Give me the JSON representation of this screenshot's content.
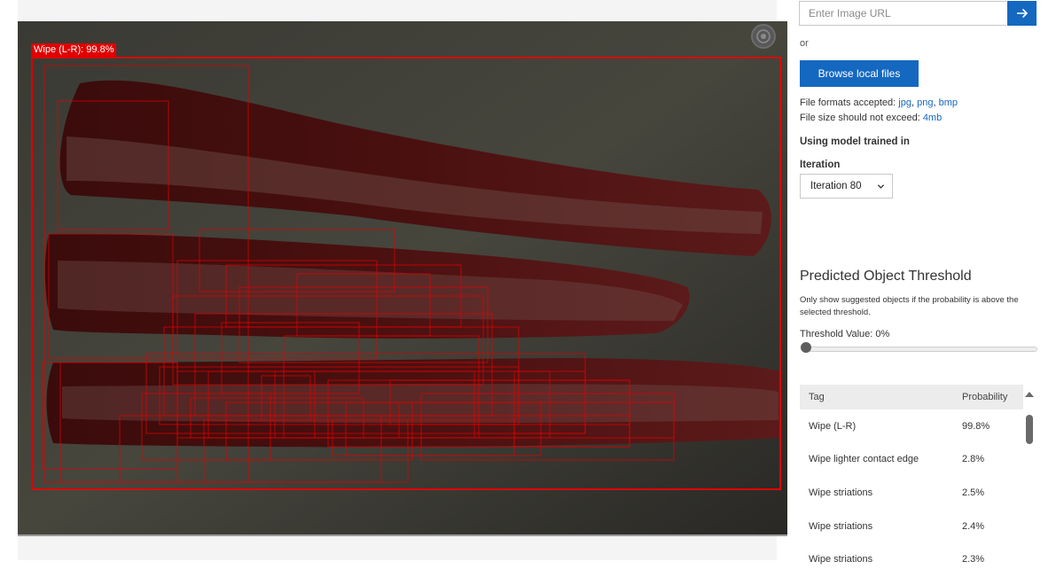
{
  "image_panel": {
    "top_detection_label": "Wipe (L-R): 99.8%",
    "zoom_icon": "focus-target-icon",
    "box_color": "#e00000"
  },
  "upload": {
    "url_placeholder": "Enter Image URL",
    "go_icon": "arrow-right-icon",
    "or_text": "or",
    "browse_label": "Browse local files",
    "formats_prefix": "File formats accepted:",
    "format_jpg": "jpg",
    "format_png": "png",
    "format_bmp": "bmp",
    "size_prefix": "File size should not exceed:",
    "size_limit": "4mb",
    "accent_color": "#1468c0"
  },
  "model": {
    "using_label": "Using model trained in",
    "iteration_label": "Iteration",
    "iteration_value": "Iteration 80"
  },
  "threshold": {
    "title": "Predicted Object Threshold",
    "description": "Only show suggested objects if the probability is above the selected threshold.",
    "value_label": "Threshold Value: 0%",
    "value": 0
  },
  "tags_table": {
    "col_tag": "Tag",
    "col_probability": "Probability",
    "rows": [
      {
        "tag": "Wipe (L-R)",
        "probability": "99.8%"
      },
      {
        "tag": "Wipe lighter contact edge",
        "probability": "2.8%"
      },
      {
        "tag": "Wipe striations",
        "probability": "2.5%"
      },
      {
        "tag": "Wipe striations",
        "probability": "2.4%"
      },
      {
        "tag": "Wipe striations",
        "probability": "2.3%"
      }
    ]
  }
}
